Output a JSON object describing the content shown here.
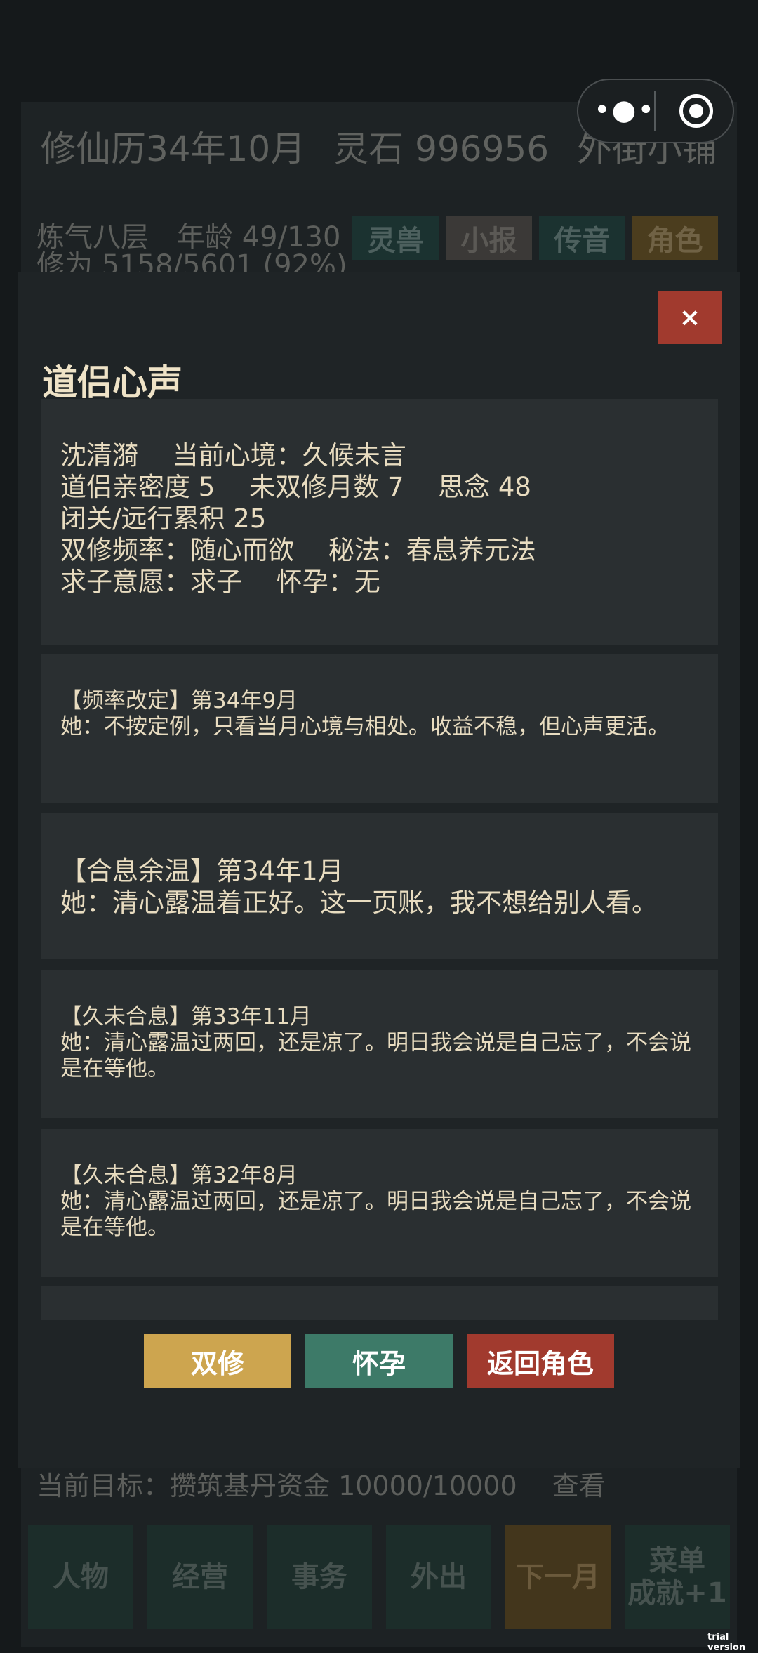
{
  "background": {
    "date": "修仙历34年10月",
    "spirit_stones": "灵石 996956",
    "shop": "外街小铺",
    "status_line1": "炼气八层　年龄 49/130",
    "status_line2": "修为 5158/5601 (92%)",
    "tabs": [
      "灵兽",
      "小报",
      "传音",
      "角色"
    ],
    "goal": "当前目标：攒筑基丹资金 10000/10000　 查看",
    "nav": [
      "人物",
      "经营",
      "事务",
      "外出",
      "下一月",
      "菜单\n成就+1"
    ]
  },
  "capsule": {
    "menu_glyph": "•●•"
  },
  "modal": {
    "close_label": "×",
    "title": "道侣心声",
    "info": [
      "沈清漪　 当前心境：久候未言",
      "道侣亲密度 5　 未双修月数 7　 思念 48",
      "闭关/远行累积 25",
      "双修频率：随心而欲　 秘法：春息养元法",
      "求子意愿：求子　 怀孕：无"
    ],
    "messages": [
      {
        "title": "【频率改定】第34年9月",
        "text": "她：不按定例，只看当月心境与相处。收益不稳，但心声更活。"
      },
      {
        "title": "【合息余温】第34年1月",
        "text": "她：清心露温着正好。这一页账，我不想给别人看。"
      },
      {
        "title": "【久未合息】第33年11月",
        "text": "她：清心露温过两回，还是凉了。明日我会说是自己忘了，不会说是在等他。"
      },
      {
        "title": "【久未合息】第32年8月",
        "text": "她：清心露温过两回，还是凉了。明日我会说是自己忘了，不会说是在等他。"
      }
    ],
    "actions": {
      "dual": "双修",
      "pregnant": "怀孕",
      "back": "返回角色"
    }
  },
  "watermark": "trial version"
}
